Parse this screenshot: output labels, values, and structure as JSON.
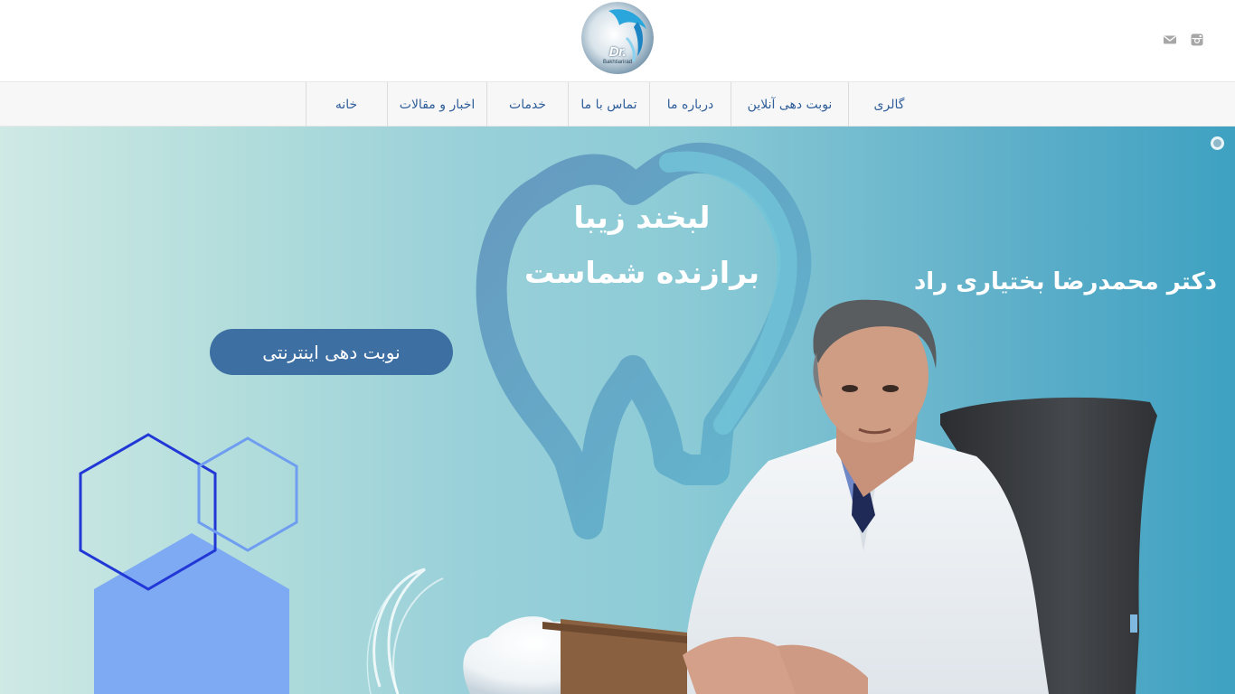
{
  "header": {
    "logo_text": "Dr.",
    "logo_subtitle": "Bakhtiarirad",
    "social": [
      {
        "name": "mail-icon",
        "color": "#a0a0a0"
      },
      {
        "name": "instagram-icon",
        "color": "#a0a0a0"
      }
    ]
  },
  "nav": {
    "items": [
      {
        "label": "خانه"
      },
      {
        "label": "اخبار و مقالات"
      },
      {
        "label": "خدمات"
      },
      {
        "label": "تماس با ما"
      },
      {
        "label": "درباره ما"
      },
      {
        "label": "نوبت دهی آنلاین"
      },
      {
        "label": "گالری"
      }
    ]
  },
  "hero": {
    "tagline_1": "لبخند زیبا",
    "tagline_2": "برازنده شماست",
    "doctor_name": "دکتر محمدرضا بختیاری راد",
    "cta_label": "نوبت دهی اینترنتی"
  },
  "colors": {
    "accent": "#3d6fa3",
    "nav_text": "#2f5e9a",
    "hero_light": "#cfe9e5",
    "hero_dark": "#3ea1c1"
  }
}
